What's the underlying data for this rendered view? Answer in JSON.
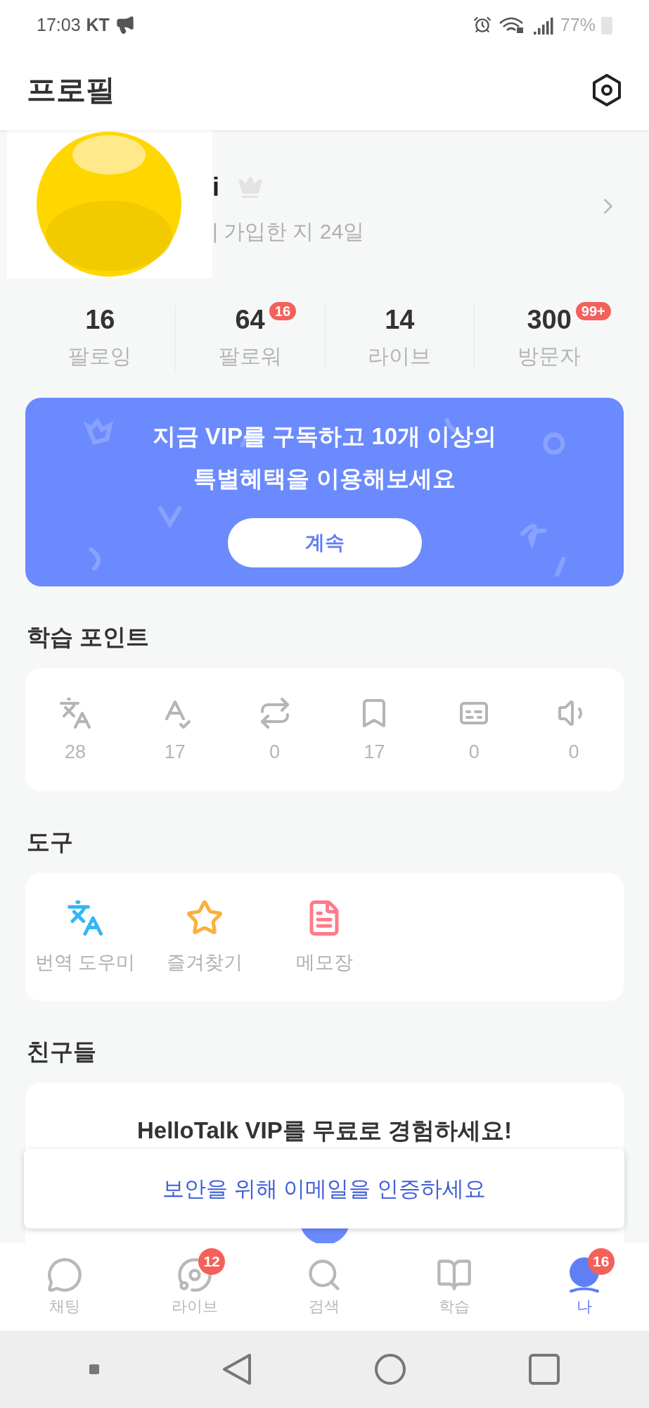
{
  "status_bar": {
    "time": "17:03",
    "carrier": "KT",
    "battery": "77%"
  },
  "header": {
    "title": "프로필"
  },
  "profile": {
    "name": "i",
    "subtitle": "| 가입한 지 24일"
  },
  "stats": [
    {
      "value": "16",
      "label": "팔로잉"
    },
    {
      "value": "64",
      "label": "팔로워",
      "badge": "16"
    },
    {
      "value": "14",
      "label": "라이브"
    },
    {
      "value": "300",
      "label": "방문자",
      "badge": "99+"
    }
  ],
  "vip_banner": {
    "lines": [
      "지금 VIP를 구독하고 10개 이상의",
      "특별혜택을 이용해보세요"
    ],
    "button": "계속"
  },
  "learning_points": {
    "title": "학습 포인트",
    "items": [
      {
        "value": "28"
      },
      {
        "value": "17"
      },
      {
        "value": "0"
      },
      {
        "value": "17"
      },
      {
        "value": "0"
      },
      {
        "value": "0"
      }
    ]
  },
  "tools": {
    "title": "도구",
    "items": [
      {
        "label": "번역 도우미",
        "color": "#35b6f5"
      },
      {
        "label": "즐겨찾기",
        "color": "#fbb03b"
      },
      {
        "label": "메모장",
        "color": "#ff7a8a"
      }
    ]
  },
  "friends": {
    "title": "친구들",
    "card_text": "HelloTalk VIP를 무료로 경험하세요!"
  },
  "toast": {
    "text": "보안을 위해 이메일을 인증하세요"
  },
  "bottom_nav": [
    {
      "label": "채팅",
      "selected": false
    },
    {
      "label": "라이브",
      "selected": false,
      "badge": "12"
    },
    {
      "label": "검색",
      "selected": false
    },
    {
      "label": "학습",
      "selected": false
    },
    {
      "label": "나",
      "selected": true,
      "badge": "16"
    }
  ]
}
